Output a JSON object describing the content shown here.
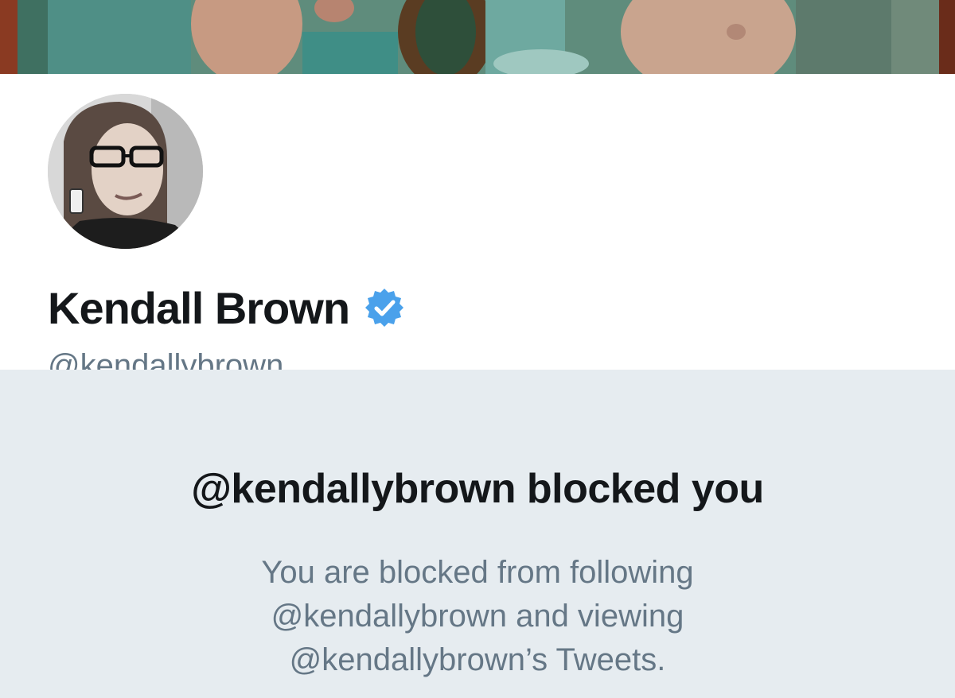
{
  "profile": {
    "display_name": "Kendall Brown",
    "handle": "@kendallybrown",
    "verified": true,
    "verified_badge_color": "#4aa1eb"
  },
  "blocked_notice": {
    "title": "@kendallybrown blocked you",
    "message": "You are blocked from following @kendallybrown and viewing @kendallybrown’s Tweets."
  },
  "colors": {
    "name_text": "#14171a",
    "secondary_text": "#657786",
    "panel_background": "#e6ecf0"
  }
}
